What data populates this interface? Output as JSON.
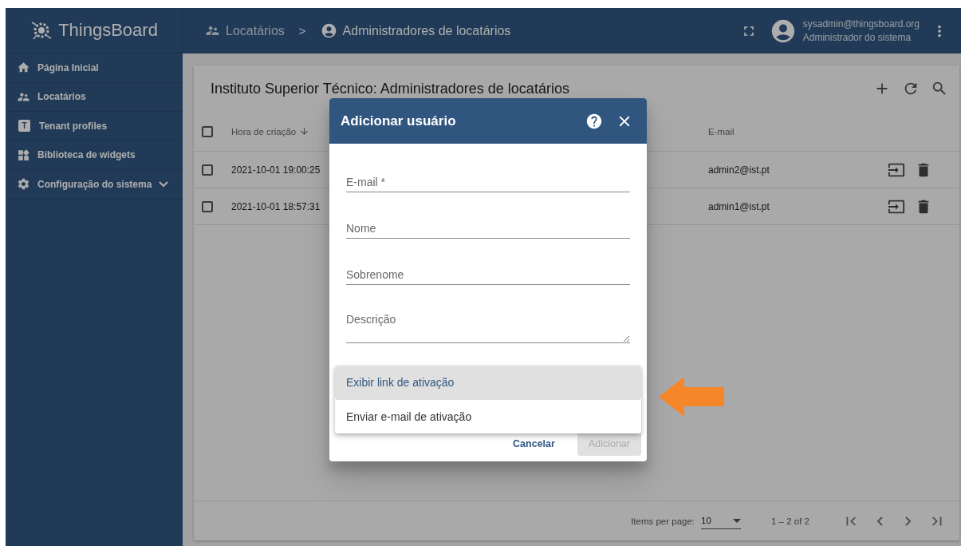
{
  "app": {
    "logo": "ThingsBoard"
  },
  "breadcrumbs": [
    {
      "label": "Locatários"
    },
    {
      "label": "Administradores de locatários"
    }
  ],
  "breadcrumb_separator": ">",
  "user": {
    "email": "sysadmin@thingsboard.org",
    "role": "Administrador do sistema"
  },
  "sidebar": {
    "items": [
      {
        "label": "Página Inicial",
        "expandable": false
      },
      {
        "label": "Locatários",
        "expandable": false
      },
      {
        "label": "Tenant profiles",
        "icon_letter": "T",
        "expandable": false
      },
      {
        "label": "Biblioteca de widgets",
        "expandable": false
      },
      {
        "label": "Configuração do sistema",
        "expandable": true
      }
    ]
  },
  "table": {
    "title": "Instituto Superior Técnico: Administradores de locatários",
    "all_checked": false,
    "columns": [
      {
        "label": "Hora de criação",
        "sorted": true
      },
      {
        "label": "E-mail",
        "sorted": false
      }
    ],
    "rows": [
      {
        "created": "2021-10-01 19:00:25",
        "email": "admin2@ist.pt",
        "checked": false
      },
      {
        "created": "2021-10-01 18:57:31",
        "email": "admin1@ist.pt",
        "checked": false
      }
    ],
    "paginator": {
      "label": "Items per page:",
      "page_size": "10",
      "range": "1 – 2 of 2"
    }
  },
  "dialog": {
    "title": "Adicionar usuário",
    "fields": [
      {
        "placeholder": "E-mail *",
        "kind": "input"
      },
      {
        "placeholder": "Nome",
        "kind": "input"
      },
      {
        "placeholder": "Sobrenome",
        "kind": "input"
      },
      {
        "placeholder": "Descrição",
        "kind": "textarea"
      }
    ],
    "menu": [
      {
        "label": "Exibir link de ativação",
        "selected": true
      },
      {
        "label": "Enviar e-mail de ativação",
        "selected": false
      }
    ],
    "buttons": [
      {
        "label": "Cancelar",
        "disabled": false
      },
      {
        "label": "Adicionar",
        "disabled": true
      }
    ]
  }
}
